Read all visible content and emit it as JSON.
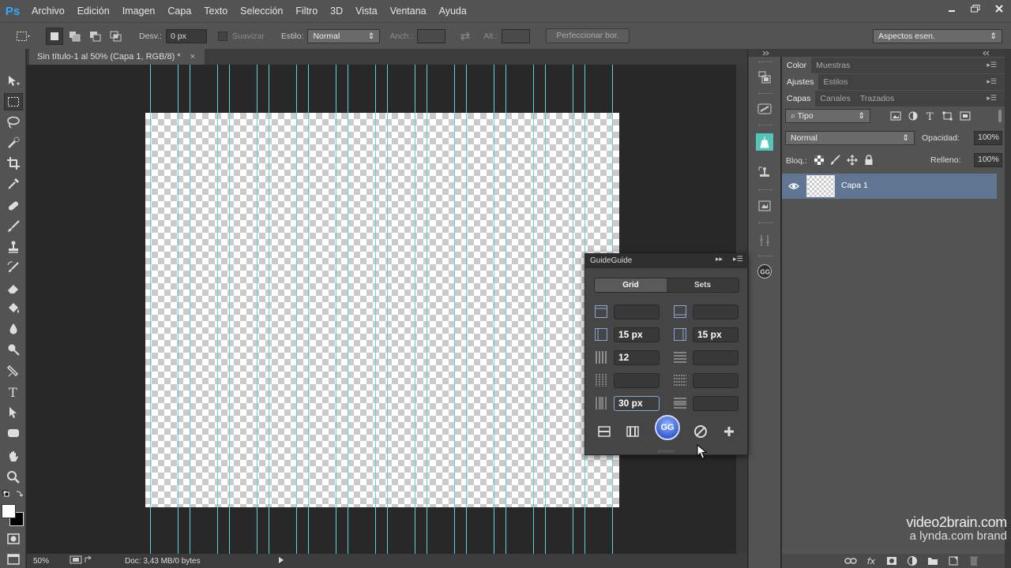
{
  "app": {
    "logo": "Ps"
  },
  "menu": [
    "Archivo",
    "Edición",
    "Imagen",
    "Capa",
    "Texto",
    "Selección",
    "Filtro",
    "3D",
    "Vista",
    "Ventana",
    "Ayuda"
  ],
  "options": {
    "feather_label": "Desv.:",
    "feather_value": "0 px",
    "antialias_label": "Suavizar",
    "style_label": "Estilo:",
    "style_value": "Normal",
    "width_label": "Anch.:",
    "height_label": "Alt.:",
    "refine_label": "Perfeccionar bor.",
    "workspace_value": "Aspectos esen."
  },
  "document": {
    "tab_title": "Sin título-1 al 50% (Capa 1, RGB/8) *",
    "close": "×"
  },
  "status": {
    "zoom": "50%",
    "doc_info": "Doc: 3,43 MB/0 bytes"
  },
  "panels": {
    "color_tabs": [
      "Color",
      "Muestras"
    ],
    "adjust_tabs": [
      "Ajustes",
      "Estilos"
    ],
    "layers_tabs": [
      "Capas",
      "Canales",
      "Trazados"
    ],
    "filter_kind": "Tipo",
    "blend_mode": "Normal",
    "opacity_label": "Opacidad:",
    "opacity_value": "100%",
    "lock_label": "Bloq.:",
    "fill_label": "Relleno:",
    "fill_value": "100%",
    "layer_name": "Capa 1"
  },
  "guideguide": {
    "title": "GuideGuide",
    "tabs": [
      "Grid",
      "Sets"
    ],
    "fields": {
      "left_margin": "",
      "right_margin": "",
      "left_col_margin": "15 px",
      "right_col_margin": "15 px",
      "columns": "12",
      "rows": "",
      "column_width": "",
      "row_height": "",
      "gutter": "30 px",
      "row_gutter": ""
    },
    "logo_text": "GG"
  },
  "watermark": {
    "line1": "video2brain.com",
    "line2": "a lynda.com brand"
  },
  "colors": {
    "guide": "#5fd3d3",
    "selected_layer": "#5f7591",
    "ps_blue": "#31a8ff"
  }
}
